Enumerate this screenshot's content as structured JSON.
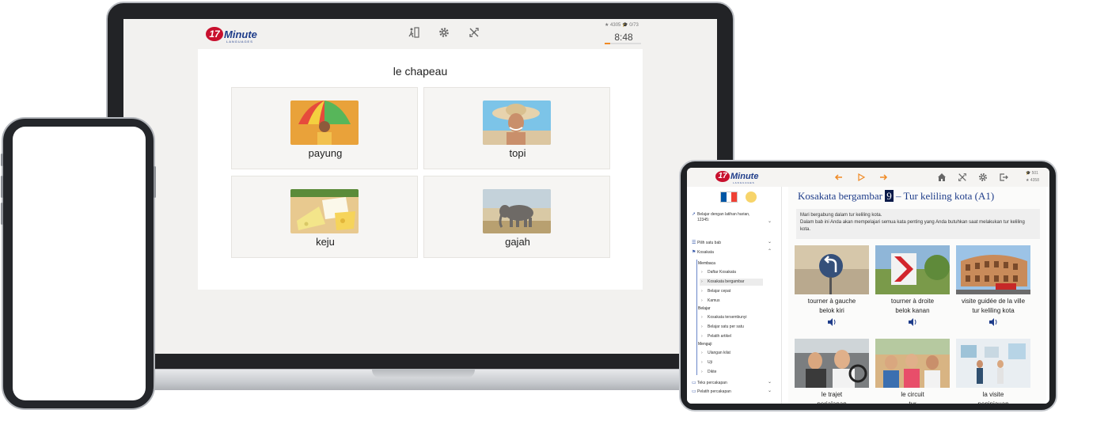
{
  "laptop": {
    "logo": {
      "number": "17",
      "word": "Minute",
      "sub": "LANGUAGES"
    },
    "stats": {
      "stars": "★ 4305",
      "caps": "🎓 0/73"
    },
    "timer": "8:48",
    "timer_progress": 0.15,
    "quiz": {
      "word": "le chapeau",
      "options": [
        {
          "label": "payung"
        },
        {
          "label": "topi"
        },
        {
          "label": "keju"
        },
        {
          "label": "gajah"
        }
      ]
    }
  },
  "tablet": {
    "logo": {
      "number": "17",
      "word": "Minute",
      "sub": "LANGUAGES"
    },
    "stats": {
      "caps": "🎓 501",
      "stars": "★ 4358"
    },
    "sidebar": {
      "daily_label": "Belajar dengan latihan harian,",
      "daily_code": "12345:",
      "pick_chapter": "Pilih satu bab",
      "vocabulary": "Kosakata",
      "sec_read": "Membaca",
      "read_items": [
        "Daftar Kosakata",
        "Kosakata bergambar",
        "Belajar cepat",
        "Kamus"
      ],
      "sec_learn": "Belajar",
      "learn_items": [
        "Kosakata tersembunyi",
        "Belajar satu per satu",
        "Pelatih artikel"
      ],
      "sec_test": "Menguji",
      "test_items": [
        "Ulangan kilat",
        "Uji",
        "Dikte"
      ],
      "conversation": "Teks percakapan",
      "conv_trainer": "Pelatih percakapan"
    },
    "main": {
      "title_pre": "Kosakata bergambar",
      "title_num": "9",
      "title_post": "– Tur keliling kota (A1)",
      "desc_line1": "Mari bergabung dalam tur keliling kota.",
      "desc_line2": "Dalam bab ini Anda akan mempelajari semua kata penting yang Anda butuhkan saat melakukan tur keliling kota.",
      "cards": [
        {
          "fr": "tourner à gauche",
          "id": "belok kiri"
        },
        {
          "fr": "tourner à droite",
          "id": "belok kanan"
        },
        {
          "fr": "visite guidée de la ville",
          "id": "tur keliling kota"
        },
        {
          "fr": "le trajet",
          "id": "perjalanan"
        },
        {
          "fr": "le circuit",
          "id": "tur"
        },
        {
          "fr": "la visite",
          "id": "peninjauan"
        }
      ]
    }
  },
  "colors": {
    "brand_blue": "#1f3d8a",
    "brand_red": "#c8102e",
    "accent_orange": "#f08a24"
  }
}
